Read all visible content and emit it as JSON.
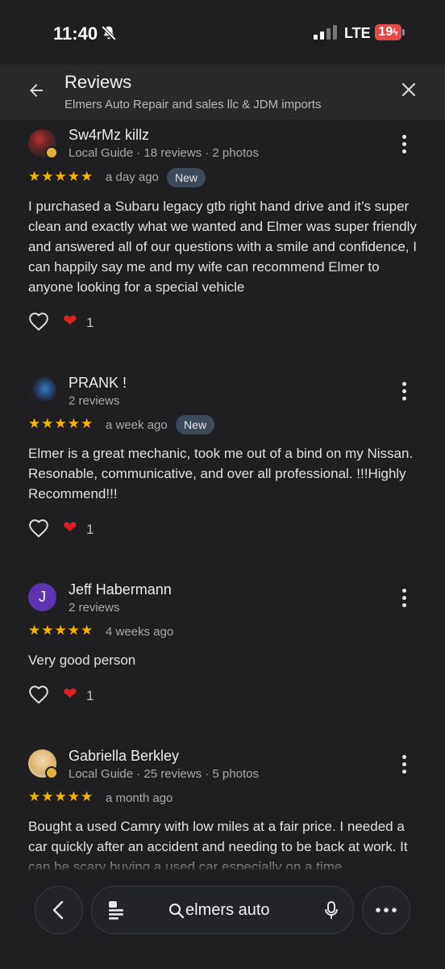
{
  "status_bar": {
    "time": "11:40",
    "network": "LTE",
    "battery": "19"
  },
  "header": {
    "title": "Reviews",
    "subtitle": "Elmers Auto Repair and sales llc & JDM imports"
  },
  "reviews": [
    {
      "name": "Sw4rMz killz",
      "meta": "Local Guide · 18 reviews · 2 photos",
      "stars": "★★★★★",
      "ago": "a day ago",
      "badge": "New",
      "text": "I purchased a Subaru legacy gtb right hand drive and it’s super clean and exactly what we wanted and Elmer was super friendly and answered all of our questions with a smile and confidence, I can happily say me and my wife can recommend Elmer to anyone looking for a special vehicle",
      "reaction_count": "1"
    },
    {
      "name": "PRANK !",
      "meta": "2 reviews",
      "stars": "★★★★★",
      "ago": "a week ago",
      "badge": "New",
      "text": "Elmer is a great mechanic, took me out of a bind on my Nissan. Resonable, communicative, and over all professional. !!!Highly Recommend!!!",
      "reaction_count": "1"
    },
    {
      "name": "Jeff Habermann",
      "initial": "J",
      "meta": "2 reviews",
      "stars": "★★★★★",
      "ago": "4 weeks ago",
      "text": "Very good person",
      "reaction_count": "1"
    },
    {
      "name": "Gabriella Berkley",
      "meta": "Local Guide · 25 reviews · 5 photos",
      "stars": "★★★★★",
      "ago": "a month ago",
      "text": "Bought a used Camry with low miles at a fair price. I needed a car quickly after an accident and needing to be back at work. It can be scary buying a used car especially on a time"
    }
  ],
  "bottom_bar": {
    "search_text": "elmers auto"
  },
  "colors": {
    "star": "#f4b400",
    "heart": "#e02020",
    "avatar_j": "#5e35b1"
  }
}
